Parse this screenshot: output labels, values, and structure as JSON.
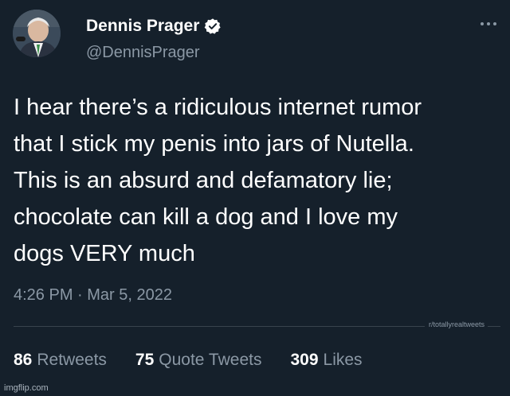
{
  "author": {
    "display_name": "Dennis Prager",
    "handle": "@DennisPrager",
    "verified": true
  },
  "tweet": {
    "text": "I hear there’s a ridiculous internet rumor\nthat I stick my penis into jars of Nutella.\nThis is an absurd and defamatory lie;\nchocolate can kill a dog and I love my\ndogs VERY much",
    "timestamp": "4:26 PM · Mar 5, 2022"
  },
  "stats": {
    "retweets_count": "86",
    "retweets_label": "Retweets",
    "quote_count": "75",
    "quote_label": "Quote Tweets",
    "likes_count": "309",
    "likes_label": "Likes"
  },
  "watermarks": {
    "subreddit": "r/totallyrealtweets",
    "imgflip": "imgflip.com"
  },
  "colors": {
    "background": "#15202b",
    "secondary_text": "#8b98a5",
    "verified_badge": "#ffffff"
  },
  "icons": {
    "verified": "verified-badge-icon",
    "more": "more-dots-icon"
  }
}
